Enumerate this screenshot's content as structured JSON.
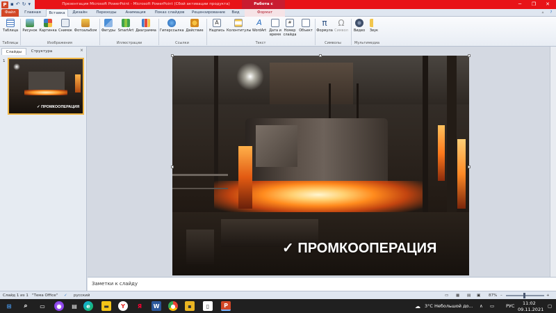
{
  "title_bar": {
    "title": "Презентация Microsoft PowerPoint  -  Microsoft PowerPoint (Сбой активации продукта)",
    "context_tab": "Работа с рисунками"
  },
  "tabs": [
    "Файл",
    "Главная",
    "Вставка",
    "Дизайн",
    "Переходы",
    "Анимация",
    "Показ слайдов",
    "Рецензирование",
    "Вид",
    "Формат"
  ],
  "ribbon": {
    "buttons": {
      "table": "Таблица",
      "picture": "Рисунок",
      "clipart": "Картинка",
      "screenshot": "Снимок",
      "photo_album": "Фотоальбом",
      "shapes": "Фигуры",
      "smartart": "SmartArt",
      "chart": "Диаграмма",
      "hyperlink": "Гиперссылка",
      "action": "Действие",
      "textbox": "Надпись",
      "header_footer": "Колонтитулы",
      "wordart": "WordArt",
      "datetime_line1": "Дата и",
      "datetime_line2": "время",
      "slide_number_line1": "Номер",
      "slide_number_line2": "слайда",
      "object": "Объект",
      "equation": "Формула",
      "symbol": "Символ",
      "video": "Видео",
      "audio": "Звук"
    },
    "groups": {
      "tables": "Таблицы",
      "images": "Изображения",
      "illustrations": "Иллюстрации",
      "links": "Ссылки",
      "text": "Текст",
      "symbols": "Символы",
      "media": "Мультимедиа"
    }
  },
  "left_panel": {
    "tabs": [
      "Слайды",
      "Структура"
    ],
    "close": "×",
    "slide_number": "1"
  },
  "slide": {
    "caption": "✓ ПРОМКООПЕРАЦИЯ"
  },
  "notes": {
    "placeholder": "Заметки к слайду"
  },
  "status_bar": {
    "slide_info": "Слайд 1 из 1",
    "theme": "\"Тема Office\"",
    "language": "русский",
    "zoom": "87%",
    "minus": "–",
    "plus": "+"
  },
  "taskbar": {
    "weather": "3°C  Небольшой до...",
    "lang": "РУС",
    "time": "11:02",
    "date": "09.11.2021"
  },
  "colors": {
    "brand": "#d24726",
    "title_bar": "#e81318"
  }
}
